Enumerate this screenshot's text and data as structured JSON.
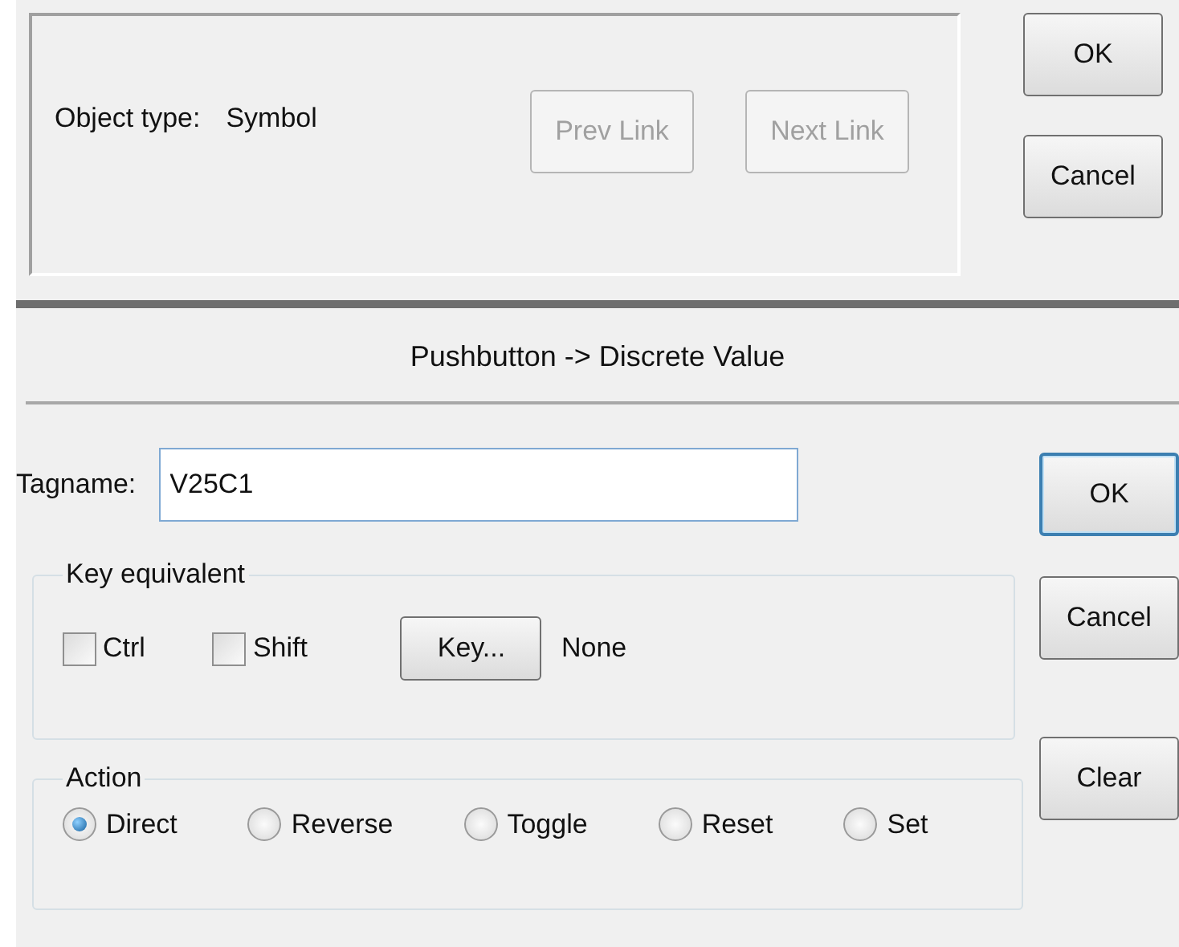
{
  "top_dialog": {
    "object_type_label": "Object type:",
    "object_type_value": "Symbol",
    "link_buttons": [
      {
        "label": "Prev Link",
        "disabled": true
      },
      {
        "label": "Next Link",
        "disabled": true
      }
    ],
    "side_buttons": [
      {
        "label": "OK",
        "default": false
      },
      {
        "label": "Cancel",
        "default": false
      }
    ]
  },
  "dialog": {
    "title": "Pushbutton -> Discrete Value",
    "tagname": {
      "label": "Tagname:",
      "value": "V25C1"
    },
    "key_equivalent": {
      "title": "Key equivalent",
      "modifiers": [
        {
          "label": "Ctrl",
          "checked": false
        },
        {
          "label": "Shift",
          "checked": false
        }
      ],
      "key_button": "Key...",
      "key_value": "None"
    },
    "action": {
      "title": "Action",
      "options": [
        {
          "label": "Direct",
          "selected": true
        },
        {
          "label": "Reverse",
          "selected": false
        },
        {
          "label": "Toggle",
          "selected": false
        },
        {
          "label": "Reset",
          "selected": false
        },
        {
          "label": "Set",
          "selected": false
        }
      ]
    },
    "buttons": [
      {
        "label": "OK",
        "default": true
      },
      {
        "label": "Cancel",
        "default": false
      },
      {
        "label": "Clear",
        "default": false
      }
    ]
  }
}
